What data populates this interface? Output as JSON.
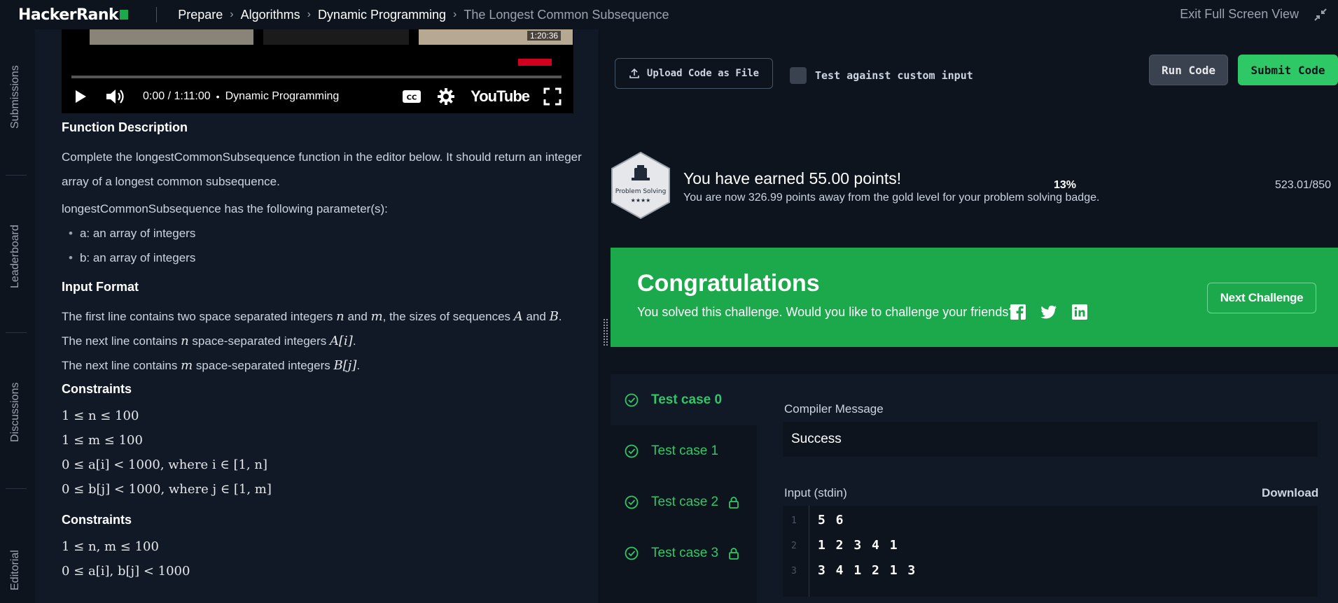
{
  "header": {
    "logo_text": "HackerRank",
    "breadcrumb": [
      "Prepare",
      "Algorithms",
      "Dynamic Programming",
      "The Longest Common Subsequence"
    ],
    "exit_fullscreen": "Exit Full Screen View"
  },
  "rail": {
    "items": [
      "Submissions",
      "Leaderboard",
      "Discussions",
      "Editorial"
    ]
  },
  "video": {
    "timestamp_badge": "1:20:36",
    "time": "0:00 / 1:11:00",
    "separator": "•",
    "chapter": "Dynamic Programming",
    "brand": "YouTube",
    "progress": 0.0
  },
  "description": {
    "function_heading": "Function Description",
    "function_text": "Complete the longestCommonSubsequence function in the editor below. It should return an integer array of a longest common subsequence.",
    "params_intro": "longestCommonSubsequence has the following parameter(s):",
    "params": [
      "a: an array of integers",
      "b: an array of integers"
    ],
    "input_heading": "Input Format",
    "input_line1_pre": "The first line contains two space separated integers ",
    "input_line1_n": "n",
    "input_line1_and": " and ",
    "input_line1_m": "m",
    "input_line1_mid": ", the sizes of sequences ",
    "input_line1_A": "A",
    "input_line1_and2": " and ",
    "input_line1_B": "B",
    "input_line1_end": ".",
    "input_line2_pre": "The next line contains ",
    "input_line2_n": "n",
    "input_line2_mid": " space-separated integers ",
    "input_line2_expr": "A[i]",
    "input_line2_end": ".",
    "input_line3_pre": "The next line contains ",
    "input_line3_m": "m",
    "input_line3_mid": " space-separated integers ",
    "input_line3_expr": "B[j]",
    "input_line3_end": ".",
    "constraints_heading": "Constraints",
    "constraints": [
      "1 ≤ n ≤ 100",
      "1 ≤ m ≤ 100",
      "0 ≤ a[i] < 1000,  where i ∈ [1, n]",
      "0 ≤ b[j] < 1000,  where j ∈ [1, m]"
    ],
    "constraints2_heading": "Constraints",
    "constraints2": [
      "1 ≤ n, m ≤ 100",
      "0 ≤ a[i], b[j] < 1000"
    ]
  },
  "toolbar": {
    "upload_label": "Upload Code as File",
    "custom_input_label": "Test against custom input",
    "run_label": "Run Code",
    "submit_label": "Submit Code"
  },
  "points": {
    "badge_label": "Problem Solving",
    "badge_stars": "★★★★",
    "earned": "You have earned 55.00 points!",
    "away": "You are now 326.99 points away from the gold level for your problem solving badge.",
    "percent": "13%",
    "total": "523.01/850"
  },
  "congrats": {
    "title": "Congratulations",
    "subtitle": "You solved this challenge. Would you like to challenge your friends?",
    "next_label": "Next Challenge"
  },
  "tests": {
    "cases": [
      {
        "label": "Test case 0",
        "locked": false
      },
      {
        "label": "Test case 1",
        "locked": false
      },
      {
        "label": "Test case 2",
        "locked": true
      },
      {
        "label": "Test case 3",
        "locked": true
      }
    ],
    "compiler_label": "Compiler Message",
    "compiler_value": "Success",
    "input_label": "Input (stdin)",
    "download_label": "Download",
    "input_lines": [
      {
        "n": "1",
        "text": "5 6"
      },
      {
        "n": "2",
        "text": "1 2 3 4 1"
      },
      {
        "n": "3",
        "text": "3 4 1 2 1 3"
      }
    ]
  },
  "colors": {
    "accent_green": "#1ba94c",
    "bright_green": "#2ec866",
    "background": "#0e141e",
    "panel": "#111926"
  }
}
